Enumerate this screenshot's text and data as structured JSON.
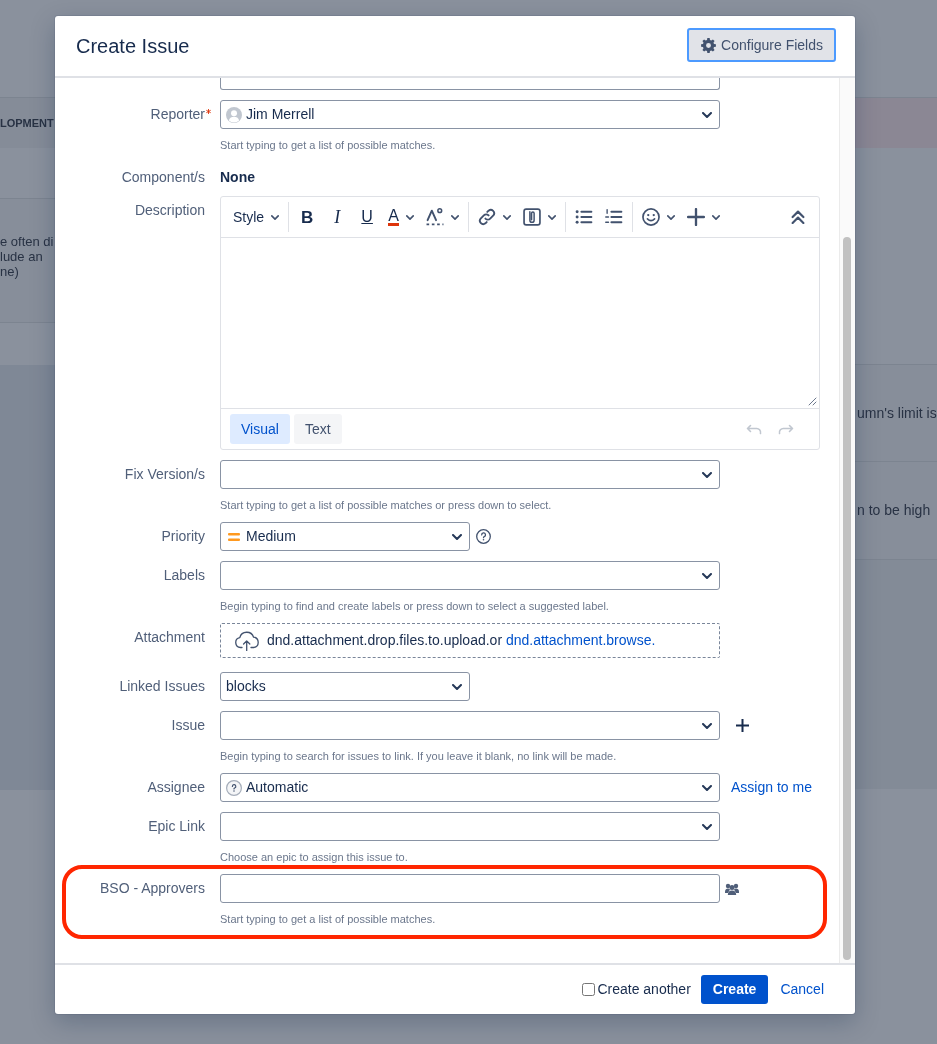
{
  "background_page": {
    "column_heading": "LOPMENT",
    "left_card_lines": [
      "e often di",
      "lude an",
      "ne)"
    ],
    "right_cards": [
      "umn's limit is",
      "n to be high"
    ]
  },
  "dialog": {
    "title": "Create Issue",
    "configure_button": {
      "label": "Configure Fields",
      "focused": true
    }
  },
  "fields": [
    {
      "kind": "cut_input",
      "required": false,
      "highlighted": false
    },
    {
      "kind": "select",
      "label": "Reporter",
      "required": true,
      "value_icon": {
        "kind": "person"
      },
      "value": "Jim Merrell",
      "hint": "Start typing to get a list of possible matches.",
      "highlighted": false
    },
    {
      "kind": "static",
      "label": "Component/s",
      "required": false,
      "value": "None",
      "highlighted": false
    },
    {
      "kind": "editor",
      "label": "Description",
      "required": false,
      "highlighted": false,
      "toolbar_groups": [
        [
          {
            "kind": "style",
            "text": "Style",
            "caret": true
          }
        ],
        [
          {
            "kind": "bold",
            "text": "B",
            "caret": false
          },
          {
            "kind": "italic",
            "text": "I",
            "caret": false
          },
          {
            "kind": "underline",
            "text": "U",
            "caret": false
          },
          {
            "kind": "text_color",
            "text": "A",
            "caret": true
          },
          {
            "kind": "format",
            "caret": true
          }
        ],
        [
          {
            "kind": "link",
            "caret": true
          },
          {
            "kind": "attachment",
            "caret": true
          }
        ],
        [
          {
            "kind": "bullet_list",
            "caret": false
          },
          {
            "kind": "numbered_list",
            "caret": false
          }
        ],
        [
          {
            "kind": "emoji",
            "caret": true
          },
          {
            "kind": "insert",
            "caret": true
          }
        ]
      ],
      "toolbar_right": [
        {
          "kind": "collapse",
          "caret": false
        }
      ],
      "modes": [
        {
          "label": "Visual",
          "selected": true
        },
        {
          "label": "Text",
          "selected": false
        }
      ],
      "history": [
        {
          "kind": "undo",
          "disabled": true
        },
        {
          "kind": "redo",
          "disabled": true
        }
      ]
    },
    {
      "kind": "select",
      "label": "Fix Version/s",
      "required": false,
      "hint": "Start typing to get a list of possible matches or press down to select.",
      "highlighted": false
    },
    {
      "kind": "select_short",
      "label": "Priority",
      "required": false,
      "value_icon": {
        "kind": "priority"
      },
      "value": "Medium",
      "side": {
        "kind": "help"
      },
      "highlighted": false
    },
    {
      "kind": "select",
      "label": "Labels",
      "required": false,
      "hint": "Begin typing to find and create labels or press down to select a suggested label.",
      "highlighted": false
    },
    {
      "kind": "attachment",
      "label": "Attachment",
      "required": false,
      "text": "dnd.attachment.drop.files.to.upload.or",
      "link": "dnd.attachment.browse.",
      "highlighted": false
    },
    {
      "kind": "select_short",
      "label": "Linked Issues",
      "required": false,
      "value": "blocks",
      "highlighted": false
    },
    {
      "kind": "select",
      "label": "Issue",
      "required": false,
      "side": {
        "kind": "add"
      },
      "hint": "Begin typing to search for issues to link. If you leave it blank, no link will be made.",
      "highlighted": false
    },
    {
      "kind": "select",
      "label": "Assignee",
      "required": false,
      "value_icon": {
        "kind": "unknown_user"
      },
      "value": "Automatic",
      "side": {
        "kind": "link",
        "text": "Assign to me"
      },
      "highlighted": false
    },
    {
      "kind": "select",
      "label": "Epic Link",
      "required": false,
      "hint": "Choose an epic to assign this issue to.",
      "highlighted": false
    },
    {
      "kind": "input",
      "label": "BSO - Approvers",
      "required": false,
      "side": {
        "kind": "people"
      },
      "hint": "Start typing to get a list of possible matches.",
      "highlighted": true
    }
  ],
  "footer": {
    "create_another": {
      "label": "Create another",
      "checked": false
    },
    "create_button": "Create",
    "cancel_link": "Cancel"
  }
}
